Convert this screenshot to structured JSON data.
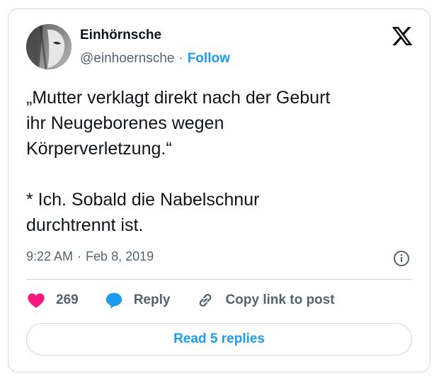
{
  "tweet": {
    "author": {
      "name": "Einhörnsche",
      "handle": "@einhoernsche",
      "follow_label": "Follow",
      "separator": "·"
    },
    "text": "„Mutter verklagt direkt nach der Geburt\nihr Neugeborenes wegen\nKörperverletzung.“\n\n* Ich. Sobald die Nabelschnur\ndurchtrennt ist.",
    "time": "9:22 AM",
    "date": "Feb 8, 2019",
    "meta_separator": "·",
    "likes": "269",
    "reply_label": "Reply",
    "copy_label": "Copy link to post",
    "read_replies_label": "Read 5 replies"
  },
  "colors": {
    "accent": "#1d9bf0",
    "like": "#f91880",
    "muted": "#536471",
    "border": "#cfd9de"
  },
  "icons": [
    "x-logo-icon",
    "info-icon",
    "heart-icon",
    "reply-bubble-icon",
    "link-icon"
  ]
}
